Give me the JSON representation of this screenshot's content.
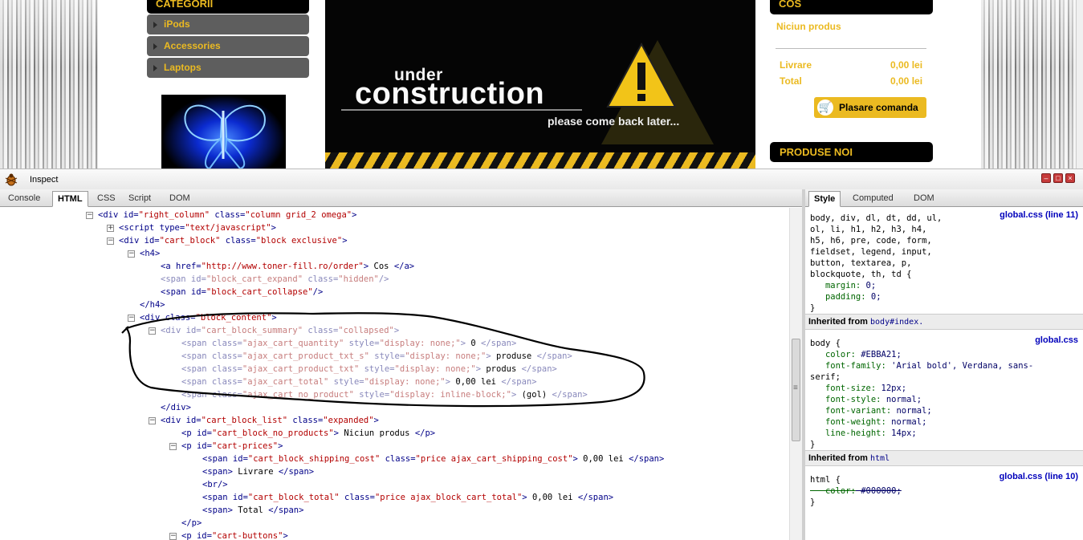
{
  "site": {
    "categories_heading": "CATEGORII",
    "categories": [
      "iPods",
      "Accessories",
      "Laptops"
    ],
    "banner": {
      "line1": "under",
      "line2": "construction",
      "line3": "please come back later..."
    },
    "cart_heading": "COS",
    "cart_empty": "Niciun produs",
    "shipping_label": "Livrare",
    "shipping_value": "0,00 lei",
    "total_label": "Total",
    "total_value": "0,00 lei",
    "order_button": "Plasare comanda",
    "new_products_heading": "PRODUSE NOI",
    "accent_color": "#EBBA21"
  },
  "inspector": {
    "title": "Inspect",
    "left_tabs": [
      "Console",
      "HTML",
      "CSS",
      "Script",
      "DOM"
    ],
    "left_active": "HTML",
    "right_tabs": [
      "Style",
      "Computed",
      "DOM"
    ],
    "right_active": "Style",
    "html_lines": [
      {
        "t": "−",
        "tag": "div",
        "attrs": [
          [
            "id",
            "right_column"
          ],
          [
            "class",
            "column grid_2 omega"
          ]
        ],
        "close": ">"
      },
      {
        "t": "+",
        "tag": "script",
        "attrs": [
          [
            "type",
            "text/javascript"
          ]
        ],
        "close": ">"
      },
      {
        "t": "−",
        "tag": "div",
        "attrs": [
          [
            "id",
            "cart_block"
          ],
          [
            "class",
            "block exclusive"
          ]
        ],
        "close": ">"
      },
      {
        "t": "−",
        "tag": "h4",
        "attrs": [],
        "close": ">"
      },
      {
        "t": "",
        "tag": "a",
        "attrs": [
          [
            "href",
            "http://www.toner-fill.ro/order"
          ]
        ],
        "close": ">",
        "text": "Cos",
        "end": "</a>"
      },
      {
        "t": "",
        "tag": "span",
        "attrs": [
          [
            "id",
            "block_cart_expand"
          ],
          [
            "class",
            "hidden"
          ]
        ],
        "close": "/>",
        "dim": true
      },
      {
        "t": "",
        "tag": "span",
        "attrs": [
          [
            "id",
            "block_cart_collapse"
          ]
        ],
        "close": "/>"
      },
      {
        "t": "",
        "raw": "</h4>"
      },
      {
        "t": "−",
        "tag": "div",
        "attrs": [
          [
            "class",
            "block_content"
          ]
        ],
        "close": ">"
      },
      {
        "t": "−",
        "tag": "div",
        "attrs": [
          [
            "id",
            "cart_block_summary"
          ],
          [
            "class",
            "collapsed"
          ]
        ],
        "close": ">",
        "dim": true
      },
      {
        "t": "",
        "tag": "span",
        "attrs": [
          [
            "class",
            "ajax_cart_quantity"
          ],
          [
            "style",
            "display: none;"
          ]
        ],
        "close": ">",
        "text": "0",
        "end": "</span>",
        "dim": true
      },
      {
        "t": "",
        "tag": "span",
        "attrs": [
          [
            "class",
            "ajax_cart_product_txt_s"
          ],
          [
            "style",
            "display: none;"
          ]
        ],
        "close": ">",
        "text": "produse",
        "end": "</span>",
        "dim": true
      },
      {
        "t": "",
        "tag": "span",
        "attrs": [
          [
            "class",
            "ajax_cart_product_txt"
          ],
          [
            "style",
            "display: none;"
          ]
        ],
        "close": ">",
        "text": "produs",
        "end": "</span>",
        "dim": true
      },
      {
        "t": "",
        "tag": "span",
        "attrs": [
          [
            "class",
            "ajax_cart_total"
          ],
          [
            "style",
            "display: none;"
          ]
        ],
        "close": ">",
        "text": "0,00 lei",
        "end": "</span>",
        "dim": true
      },
      {
        "t": "",
        "tag": "span",
        "attrs": [
          [
            "class",
            "ajax_cart_no_product"
          ],
          [
            "style",
            "display: inline-block;"
          ]
        ],
        "close": ">",
        "text": "(gol)",
        "end": "</span>",
        "dim": true
      },
      {
        "t": "",
        "raw": "</div>"
      },
      {
        "t": "−",
        "tag": "div",
        "attrs": [
          [
            "id",
            "cart_block_list"
          ],
          [
            "class",
            "expanded"
          ]
        ],
        "close": ">"
      },
      {
        "t": "",
        "tag": "p",
        "attrs": [
          [
            "id",
            "cart_block_no_products"
          ]
        ],
        "close": ">",
        "text": "Niciun produs",
        "end": "</p>"
      },
      {
        "t": "−",
        "tag": "p",
        "attrs": [
          [
            "id",
            "cart-prices"
          ]
        ],
        "close": ">"
      },
      {
        "t": "",
        "tag": "span",
        "attrs": [
          [
            "id",
            "cart_block_shipping_cost"
          ],
          [
            "class",
            "price ajax_cart_shipping_cost"
          ]
        ],
        "close": ">",
        "text": "0,00 lei",
        "end": "</span>"
      },
      {
        "t": "",
        "tag": "span",
        "attrs": [],
        "close": ">",
        "text": "Livrare",
        "end": "</span>"
      },
      {
        "t": "",
        "raw": "<br/>"
      },
      {
        "t": "",
        "tag": "span",
        "attrs": [
          [
            "id",
            "cart_block_total"
          ],
          [
            "class",
            "price ajax_block_cart_total"
          ]
        ],
        "close": ">",
        "text": "0,00 lei",
        "end": "</span>"
      },
      {
        "t": "",
        "tag": "span",
        "attrs": [],
        "close": ">",
        "text": "Total",
        "end": "</span>"
      },
      {
        "t": "",
        "raw": "</p>"
      },
      {
        "t": "−",
        "tag": "p",
        "attrs": [
          [
            "id",
            "cart-buttons"
          ]
        ],
        "close": ">"
      }
    ],
    "styles": {
      "rule1_selector": [
        "body, div, dl, dt, dd, ul,",
        "ol, li, h1, h2, h3, h4,",
        "h5, h6, pre, code, form,",
        "fieldset, legend, input,",
        "button, textarea, p,",
        "blockquote, th, td {"
      ],
      "rule1_source": "global.css (line 11)",
      "rule1_props": [
        [
          "margin",
          "0;"
        ],
        [
          "padding",
          "0;"
        ]
      ],
      "inherited1_label": "Inherited from",
      "inherited1_ref": "body#index.",
      "rule2_selector": "body {",
      "rule2_source": "global.css",
      "rule2_props": [
        [
          "color",
          "#EBBA21;"
        ],
        [
          "font-family",
          "'Arial bold', Verdana, sans-"
        ],
        [
          "font-size",
          "12px;"
        ],
        [
          "font-style",
          "normal;"
        ],
        [
          "font-variant",
          "normal;"
        ],
        [
          "font-weight",
          "normal;"
        ],
        [
          "line-height",
          "14px;"
        ]
      ],
      "rule2_wrap": "serif;",
      "inherited2_label": "Inherited from",
      "inherited2_ref": "html",
      "rule3_selector": "html {",
      "rule3_source": "global.css (line 10)",
      "rule3_props": [
        [
          "color",
          "#000000;"
        ]
      ],
      "close_brace": "}"
    }
  }
}
